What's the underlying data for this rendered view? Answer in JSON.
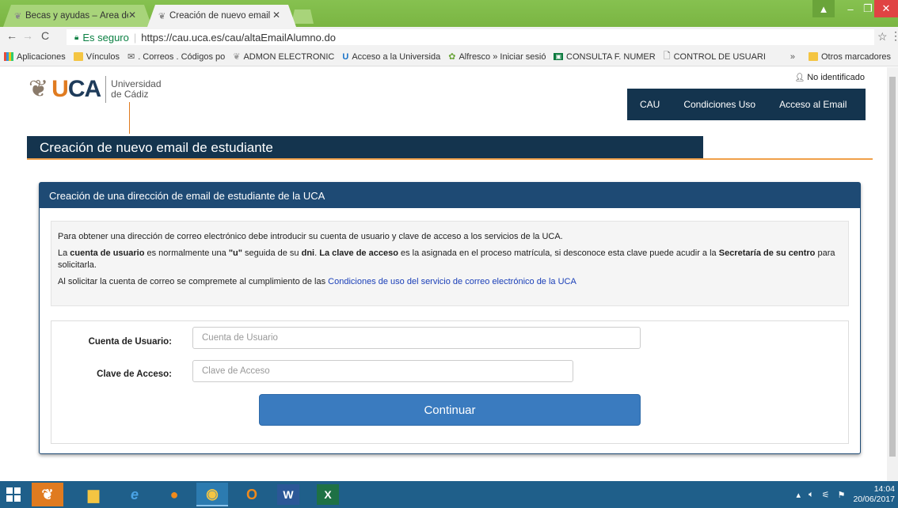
{
  "browser": {
    "tabs": [
      {
        "title": "Becas y ayudas – Área de",
        "active": false
      },
      {
        "title": "Creación de nuevo email",
        "active": true
      }
    ],
    "secure_label": "Es seguro",
    "url": "https://cau.uca.es/cau/altaEmailAlumno.do",
    "bookmarks": [
      {
        "label": "Aplicaciones",
        "icon": "apps-icon"
      },
      {
        "label": "Vínculos",
        "icon": "folder-icon"
      },
      {
        "label": ". Correos . Códigos po",
        "icon": "gmail-icon"
      },
      {
        "label": "ADMON ELECTRONIC",
        "icon": "uca-icon"
      },
      {
        "label": "Acceso a la Universida",
        "icon": "u-icon"
      },
      {
        "label": "Alfresco » Iniciar sesió",
        "icon": "alfresco-icon"
      },
      {
        "label": "CONSULTA F. NUMER",
        "icon": "junta-icon"
      },
      {
        "label": "CONTROL DE USUARI",
        "icon": "page-icon"
      }
    ],
    "bookmarks_overflow": "»",
    "other_bookmarks": "Otros marcadores"
  },
  "site": {
    "logo_text": "UCA",
    "logo_sub1": "Universidad",
    "logo_sub2": "de Cádiz",
    "user_status": "No identificado",
    "nav": {
      "cau": "CAU",
      "conditions": "Condiciones Uso",
      "email_access": "Acceso al Email"
    },
    "page_title": "Creación de nuevo email de estudiante"
  },
  "panel": {
    "heading": "Creación de una dirección de email de estudiante de la UCA",
    "info1": "Para obtener una dirección de correo electrónico debe introducir su cuenta de usuario y clave de acceso a los servicios de la UCA.",
    "info2": {
      "p1": "La ",
      "b1": "cuenta de usuario",
      "p2": " es normalmente una ",
      "b2": "\"u\"",
      "p3": " seguida de su ",
      "b3": "dni",
      "p4": ". ",
      "b4": "La clave de acceso",
      "p5": " es la asignada en el proceso matrícula, si desconoce esta clave puede acudir a la ",
      "b5": "Secretaría de su centro",
      "p6": " para solicitarla."
    },
    "info3_prefix": "Al solicitar la cuenta de correo se compremete al cumplimiento de las ",
    "info3_link": "Condiciones de uso del servicio de correo electrónico de la UCA",
    "form": {
      "user_label": "Cuenta de Usuario:",
      "user_placeholder": "Cuenta de Usuario",
      "pass_label": "Clave de Acceso:",
      "pass_placeholder": "Clave de Acceso",
      "submit_label": "Continuar"
    }
  },
  "taskbar": {
    "apps": [
      "uca-app-icon",
      "file-explorer-icon",
      "internet-explorer-icon",
      "firefox-icon",
      "chrome-icon",
      "outlook-icon",
      "word-icon",
      "excel-icon"
    ],
    "time": "14:04",
    "date": "20/06/2017"
  },
  "colors": {
    "navy": "#14344e",
    "panel_blue": "#1e4a74",
    "accent_orange": "#e07b20",
    "button_blue": "#3a7bbf",
    "chrome_green": "#7ab542"
  }
}
